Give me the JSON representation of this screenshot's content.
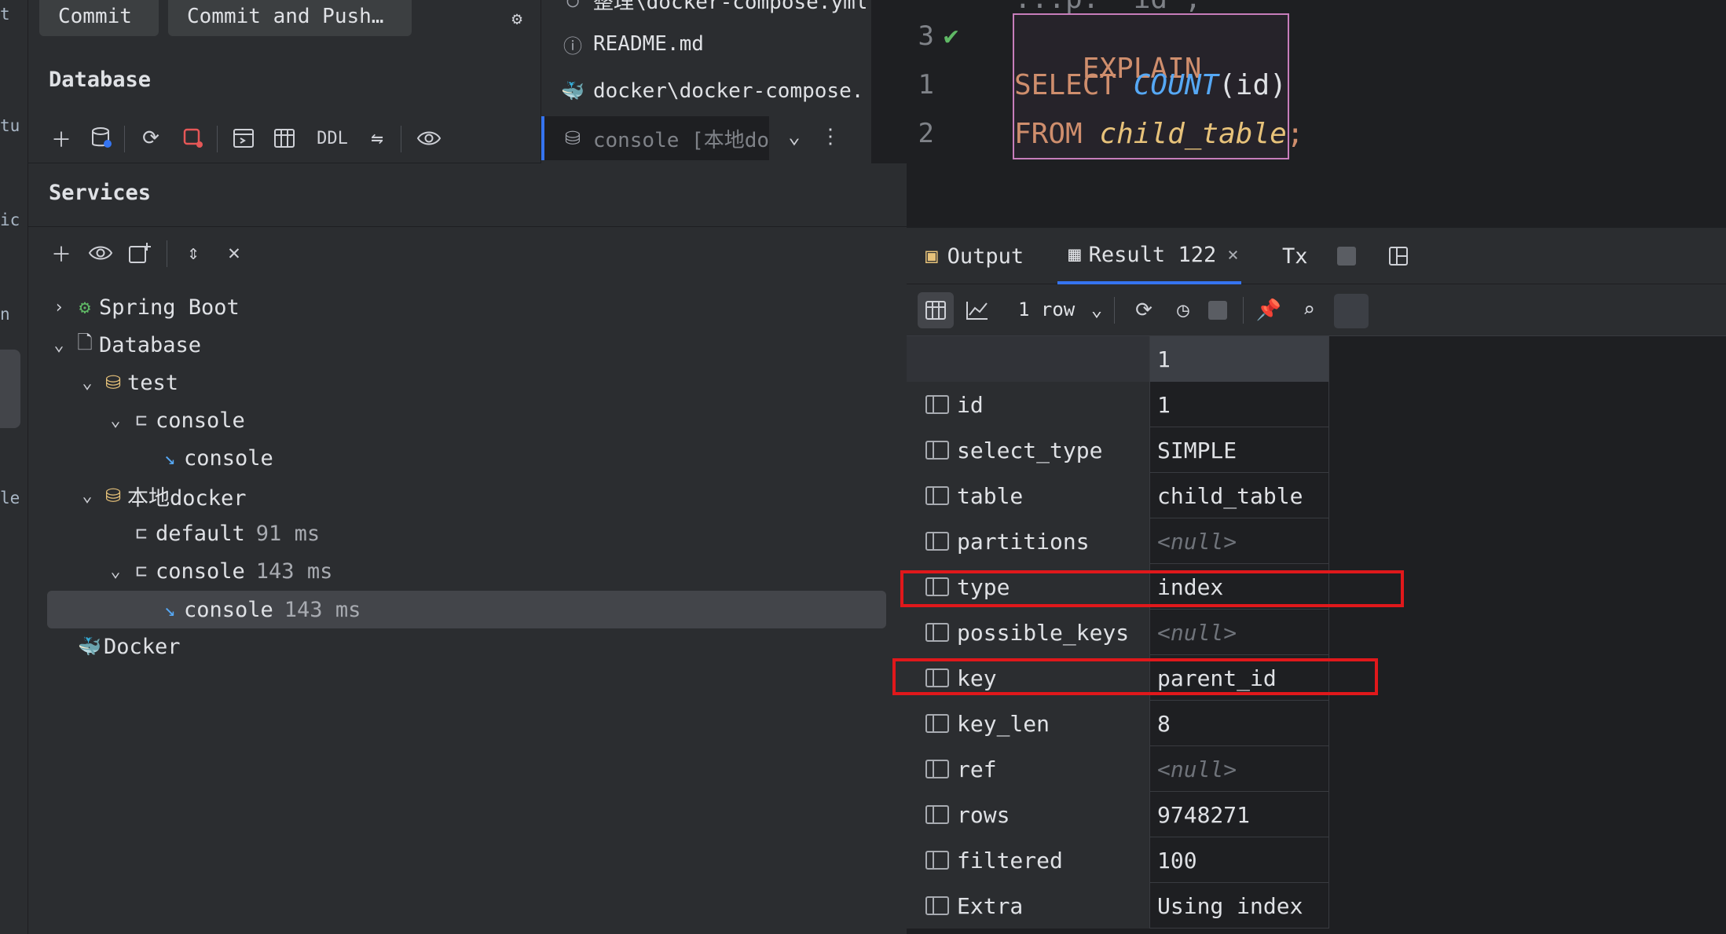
{
  "left_strip": [
    "t",
    "tu",
    "ic",
    "n",
    "le"
  ],
  "top_left": {
    "commit_label": "Commit",
    "commit_push_label": "Commit and Push…",
    "database_title": "Database",
    "ddl_label": "DDL"
  },
  "files": [
    {
      "name": "整理\\docker-compose.yml",
      "icon": "yaml-icon"
    },
    {
      "name": "README.md",
      "icon": "info-icon"
    },
    {
      "name": "docker\\docker-compose.",
      "icon": "docker-icon"
    },
    {
      "name": "console [本地do",
      "icon": "database-icon"
    }
  ],
  "editor": {
    "top_partial": "...p. _id ;",
    "lines": [
      {
        "gutter": "3",
        "keyword": "EXPLAIN"
      },
      {
        "gutter": "1",
        "keyword": "SELECT",
        "func": "COUNT",
        "arg": "(id)"
      },
      {
        "gutter": "2",
        "keyword": "FROM",
        "table": "child_table",
        "end": ";"
      }
    ]
  },
  "services": {
    "title": "Services",
    "tree": [
      {
        "label": "Spring Boot",
        "ms": ""
      },
      {
        "label": "Database",
        "ms": ""
      },
      {
        "label": "test",
        "ms": ""
      },
      {
        "label": "console",
        "ms": ""
      },
      {
        "label": "console",
        "ms": ""
      },
      {
        "label": "本地docker",
        "ms": ""
      },
      {
        "label": "default",
        "ms": "91 ms"
      },
      {
        "label": "console",
        "ms": "143 ms"
      },
      {
        "label": "console",
        "ms": "143 ms"
      },
      {
        "label": "Docker",
        "ms": ""
      }
    ]
  },
  "result": {
    "tabs": {
      "output": "Output",
      "result": "Result 122",
      "tx": "Tx"
    },
    "row_count": "1 row",
    "header": "1",
    "rows": [
      {
        "key": "id",
        "value": "1",
        "null": false
      },
      {
        "key": "select_type",
        "value": "SIMPLE",
        "null": false
      },
      {
        "key": "table",
        "value": "child_table",
        "null": false
      },
      {
        "key": "partitions",
        "value": "<null>",
        "null": true
      },
      {
        "key": "type",
        "value": "index",
        "null": false
      },
      {
        "key": "possible_keys",
        "value": "<null>",
        "null": true
      },
      {
        "key": "key",
        "value": "parent_id",
        "null": false
      },
      {
        "key": "key_len",
        "value": "8",
        "null": false
      },
      {
        "key": "ref",
        "value": "<null>",
        "null": true
      },
      {
        "key": "rows",
        "value": "9748271",
        "null": false
      },
      {
        "key": "filtered",
        "value": "100",
        "null": false
      },
      {
        "key": "Extra",
        "value": "Using index",
        "null": false
      }
    ]
  },
  "colors": {
    "highlight_red": "#e0181b",
    "accent_blue": "#3574f0",
    "code_box": "#c77dbb"
  }
}
